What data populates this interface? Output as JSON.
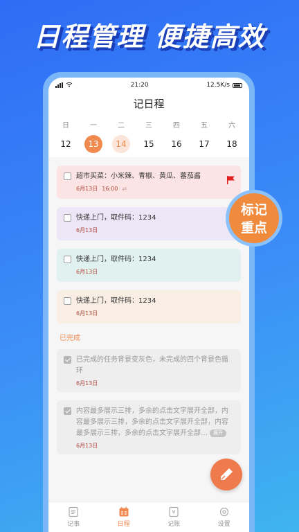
{
  "promo": {
    "title": "日程管理 便捷高效",
    "badge_line1": "标记",
    "badge_line2": "重点"
  },
  "status_bar": {
    "time": "21:20",
    "speed": "12.5K/s"
  },
  "app": {
    "title": "记日程"
  },
  "calendar": {
    "weekdays": [
      "日",
      "一",
      "二",
      "三",
      "四",
      "五",
      "六"
    ],
    "days": [
      "12",
      "13",
      "14",
      "15",
      "16",
      "17",
      "18"
    ],
    "selected_day": "13",
    "today_day": "14"
  },
  "tasks": [
    {
      "text": "超市买菜：小米辣、青椒、黄瓜、蕃茄酱",
      "date": "6月13日",
      "time": "16:00",
      "color": "#fde4e4",
      "flagged": true
    },
    {
      "text": "快递上门，取件码：1234",
      "date": "6月13日",
      "color": "#ece6f6"
    },
    {
      "text": "快递上门，取件码：1234",
      "date": "6月13日",
      "color": "#e0f1ef"
    },
    {
      "text": "快递上门，取件码：1234",
      "date": "6月13日",
      "color": "#f8eee4"
    }
  ],
  "completed": {
    "header": "已完成",
    "items": [
      {
        "text": "已完成的任务背景变灰色，未完成的四个背景色循环",
        "date": "6月13日"
      },
      {
        "text": "内容最多展示三排，多余的点击文字展开全部，内容最多展示三排，多余的点击文字展开全部，内容最多展示三排，多余的点击文字展开全部…",
        "date": "6月13日",
        "expand_label": "展开"
      }
    ]
  },
  "nav": {
    "items": [
      {
        "label": "记事",
        "icon": "notes-icon"
      },
      {
        "label": "日程",
        "icon": "calendar-icon",
        "active": true
      },
      {
        "label": "记账",
        "icon": "ledger-icon"
      },
      {
        "label": "设置",
        "icon": "gear-icon"
      }
    ]
  },
  "colors": {
    "accent": "#f08a4f",
    "flag": "#e02020",
    "background": "#2f6cf5"
  }
}
